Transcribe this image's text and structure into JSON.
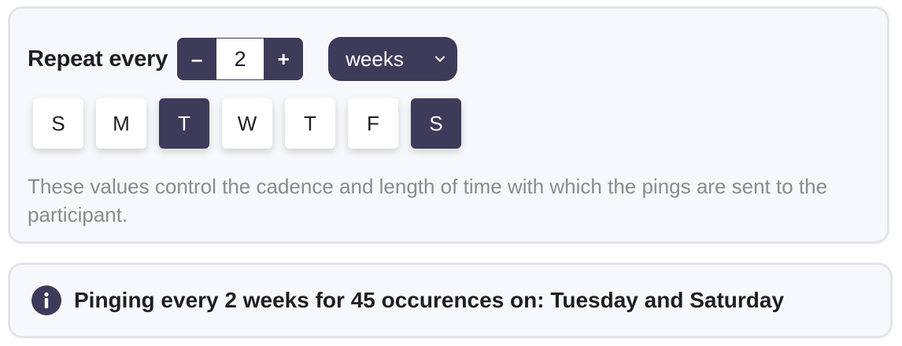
{
  "schedule": {
    "repeat_label": "Repeat every",
    "decrement_label": "–",
    "interval_value": "2",
    "increment_label": "+",
    "unit_selected": "weeks",
    "unit_icon": "chevron-down-icon",
    "days": [
      {
        "label": "S",
        "selected": false
      },
      {
        "label": "M",
        "selected": false
      },
      {
        "label": "T",
        "selected": true
      },
      {
        "label": "W",
        "selected": false
      },
      {
        "label": "T",
        "selected": false
      },
      {
        "label": "F",
        "selected": false
      },
      {
        "label": "S",
        "selected": true
      }
    ],
    "help_text": "These values control the cadence and length of time with which the pings are sent to the participant."
  },
  "summary": {
    "icon": "info-icon",
    "icon_glyph": "i",
    "text": "Pinging every 2 weeks for 45 occurences on: Tuesday and Saturday"
  },
  "colors": {
    "accent": "#3e3a59",
    "panel_bg": "#f7f8fb",
    "panel_border": "#e1e4ec",
    "help_text": "#8b8b8f"
  }
}
